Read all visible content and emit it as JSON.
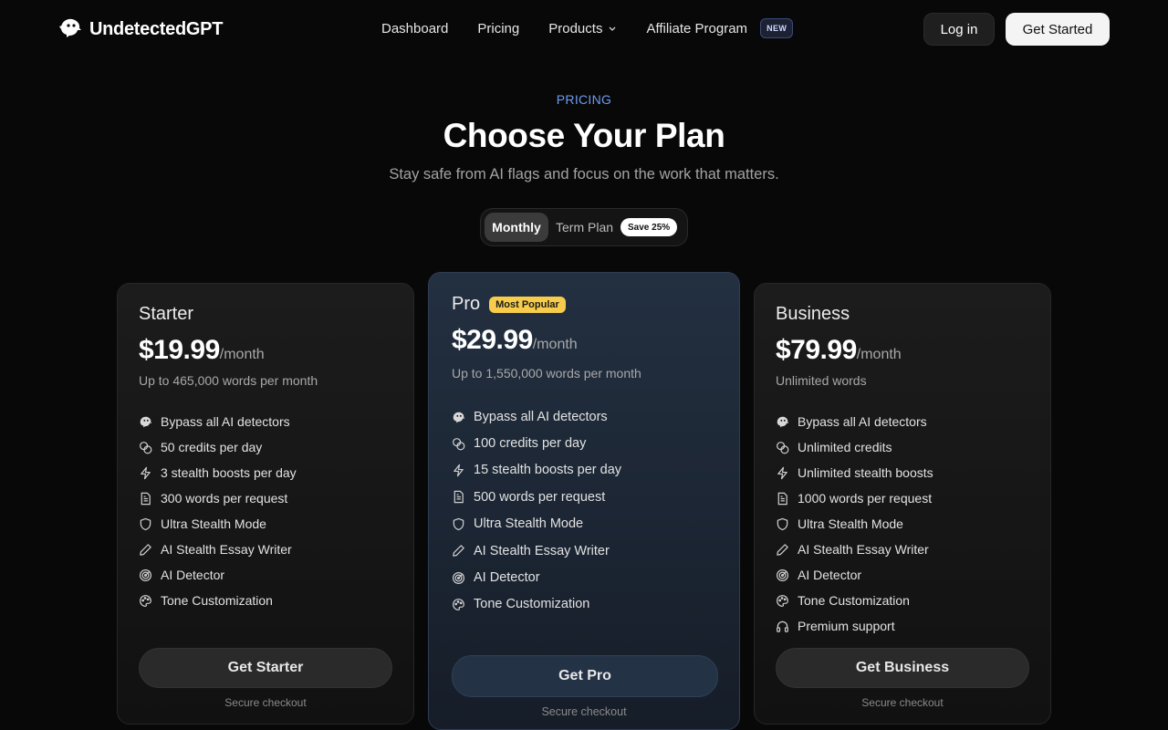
{
  "brand": {
    "name": "UndetectedGPT"
  },
  "nav": {
    "links": [
      {
        "label": "Dashboard"
      },
      {
        "label": "Pricing"
      },
      {
        "label": "Products"
      },
      {
        "label": "Affiliate Program",
        "badge": "NEW"
      }
    ],
    "login": "Log in",
    "get_started": "Get Started"
  },
  "hero": {
    "eyebrow": "PRICING",
    "title": "Choose Your Plan",
    "subtitle": "Stay safe from AI flags and focus on the work that matters."
  },
  "billing_toggle": {
    "monthly": "Monthly",
    "term": "Term Plan",
    "save": "Save 25%",
    "selected": "Monthly"
  },
  "plans": {
    "starter": {
      "name": "Starter",
      "price": "$19.99",
      "period": "/month",
      "words": "Up to 465,000 words per month",
      "features": [
        {
          "icon": "bypass-icon",
          "text": "Bypass all AI detectors"
        },
        {
          "icon": "credits-icon",
          "text": "50 credits per day"
        },
        {
          "icon": "lightning-icon",
          "text": "3 stealth boosts per day"
        },
        {
          "icon": "document-icon",
          "text": "300 words per request"
        },
        {
          "icon": "shield-icon",
          "text": "Ultra Stealth Mode"
        },
        {
          "icon": "pen-icon",
          "text": "AI Stealth Essay Writer"
        },
        {
          "icon": "radar-icon",
          "text": "AI Detector"
        },
        {
          "icon": "palette-icon",
          "text": "Tone Customization"
        }
      ],
      "cta": "Get Starter",
      "secure": "Secure checkout"
    },
    "pro": {
      "name": "Pro",
      "badge": "Most Popular",
      "price": "$29.99",
      "period": "/month",
      "words": "Up to 1,550,000 words per month",
      "features": [
        {
          "icon": "bypass-icon",
          "text": "Bypass all AI detectors"
        },
        {
          "icon": "credits-icon",
          "text": "100 credits per day"
        },
        {
          "icon": "lightning-icon",
          "text": "15 stealth boosts per day"
        },
        {
          "icon": "document-icon",
          "text": "500 words per request"
        },
        {
          "icon": "shield-icon",
          "text": "Ultra Stealth Mode"
        },
        {
          "icon": "pen-icon",
          "text": "AI Stealth Essay Writer"
        },
        {
          "icon": "radar-icon",
          "text": "AI Detector"
        },
        {
          "icon": "palette-icon",
          "text": "Tone Customization"
        }
      ],
      "cta": "Get Pro",
      "secure": "Secure checkout"
    },
    "business": {
      "name": "Business",
      "price": "$79.99",
      "period": "/month",
      "words": "Unlimited words",
      "features": [
        {
          "icon": "bypass-icon",
          "text": "Bypass all AI detectors"
        },
        {
          "icon": "credits-icon",
          "text": "Unlimited credits"
        },
        {
          "icon": "lightning-icon",
          "text": "Unlimited stealth boosts"
        },
        {
          "icon": "document-icon",
          "text": "1000 words per request"
        },
        {
          "icon": "shield-icon",
          "text": "Ultra Stealth Mode"
        },
        {
          "icon": "pen-icon",
          "text": "AI Stealth Essay Writer"
        },
        {
          "icon": "radar-icon",
          "text": "AI Detector"
        },
        {
          "icon": "palette-icon",
          "text": "Tone Customization"
        },
        {
          "icon": "headphones-icon",
          "text": "Premium support"
        }
      ],
      "cta": "Get Business",
      "secure": "Secure checkout"
    }
  },
  "colors": {
    "background": "#080808",
    "accent_eyebrow": "#6f9cf2",
    "popular_badge": "#f7cc4a",
    "pro_card": "#233041"
  }
}
